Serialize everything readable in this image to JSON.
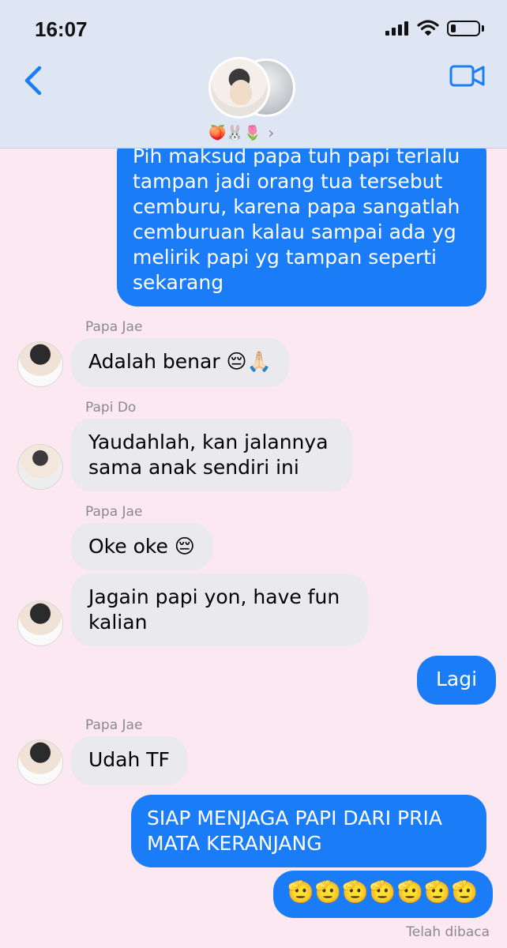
{
  "status": {
    "time": "16:07"
  },
  "header": {
    "group_emojis": "🍑🐰🌷",
    "chevron": "›"
  },
  "messages": [
    {
      "dir": "out",
      "text": "Pih maksud papa tuh papi terlalu tampan jadi orang tua tersebut cemburu, karena papa sangatlah cemburuan kalau sampai ada yg melirik papi yg tampan seperti sekarang"
    },
    {
      "dir": "in",
      "sender": "Papa Jae",
      "text": "Adalah benar 😔🙏🏻"
    },
    {
      "dir": "in",
      "sender": "Papi Do",
      "text": "Yaudahlah, kan jalannya sama anak sendiri ini"
    },
    {
      "dir": "in",
      "sender": "Papa Jae",
      "text": "Oke oke 😔"
    },
    {
      "dir": "in",
      "text": "Jagain papi yon, have fun kalian"
    },
    {
      "dir": "out",
      "text": "Lagi"
    },
    {
      "dir": "in",
      "sender": "Papa Jae",
      "text": "Udah TF"
    },
    {
      "dir": "out",
      "text": "SIAP MENJAGA PAPI DARI PRIA MATA KERANJANG"
    },
    {
      "dir": "out",
      "text": "🫡🫡🫡🫡🫡🫡🫡"
    }
  ],
  "read_receipt": "Telah dibaca",
  "colors": {
    "outgoing": "#1a7cf6",
    "incoming": "#e9e9ee",
    "background": "#fce8f0",
    "accent": "#1a7cf6"
  }
}
